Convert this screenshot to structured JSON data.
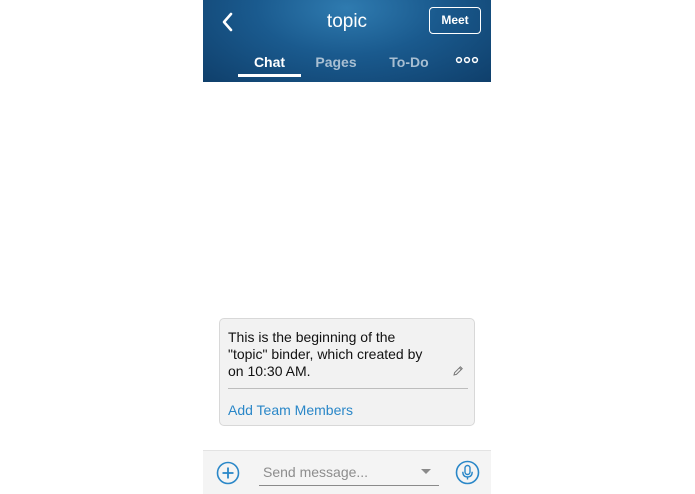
{
  "header": {
    "title": "topic",
    "meet_label": "Meet",
    "back_icon": "chevron-left-icon"
  },
  "tabs": [
    {
      "label": "Chat",
      "active": true
    },
    {
      "label": "Pages",
      "active": false
    },
    {
      "label": "To-Do",
      "active": false
    }
  ],
  "more_icon": "more-dots-icon",
  "card": {
    "line1": "This is the beginning of the",
    "line2": "\"topic\" binder, which created by",
    "line3": "on 10:30 AM.",
    "edit_icon": "pencil-icon",
    "add_members_label": "Add Team Members"
  },
  "composer": {
    "placeholder": "Send message...",
    "add_icon": "plus-circle-icon",
    "mic_icon": "microphone-icon"
  },
  "colors": {
    "header_dark": "#0f3f6b",
    "header_light": "#2f7bb0",
    "accent_blue": "#2a87c8",
    "inactive_tab": "#a9bfd2"
  }
}
